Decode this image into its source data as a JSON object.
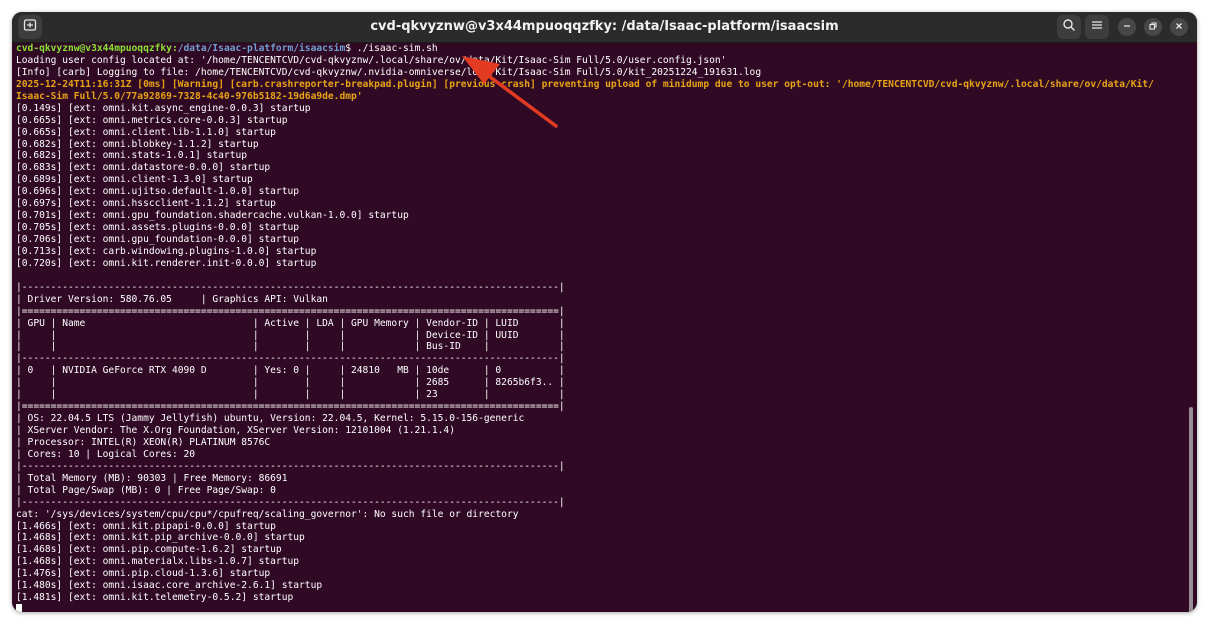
{
  "window": {
    "title": "cvd-qkvyznw@v3x44mpuoqqzfky: /data/Isaac-platform/isaacsim",
    "new_tab_icon": "new-tab-icon",
    "search_icon": "search-icon",
    "menu_icon": "hamburger-menu-icon",
    "minimize_icon": "minimize-icon",
    "maximize_icon": "maximize-icon",
    "close_icon": "close-icon"
  },
  "prompt": {
    "user_host": "cvd-qkvyznw@v3x44mpuoqqzfky",
    "path": "/data/Isaac-platform/isaacsim",
    "symbol": "$",
    "command": " ./isaac-sim.sh"
  },
  "colors": {
    "background": "#300a24",
    "text": "#ffffff",
    "warning": "#e8a316",
    "prompt_user": "#8ae234",
    "prompt_path": "#729fcf",
    "titlebar": "#2b2b2b"
  },
  "lines": [
    {
      "text": "Loading user config located at: '/home/TENCENTCVD/cvd-qkvyznw/.local/share/ov/data/Kit/Isaac-Sim Full/5.0/user.config.json'"
    },
    {
      "text": "[Info] [carb] Logging to file: /home/TENCENTCVD/cvd-qkvyznw/.nvidia-omniverse/logs/Kit/Isaac-Sim Full/5.0/kit_20251224_191631.log"
    },
    {
      "text": "2025-12-24T11:16:31Z [0ms] [Warning] [carb.crashreporter-breakpad.plugin] [previous crash] preventing upload of minidump due to user opt-out: '/home/TENCENTCVD/cvd-qkvyznw/.local/share/ov/data/Kit/",
      "style": "warn"
    },
    {
      "text": "Isaac-Sim Full/5.0/77a92869-7328-4c40-976b5182-19d6a9de.dmp'",
      "style": "warn"
    },
    {
      "text": "[0.149s] [ext: omni.kit.async_engine-0.0.3] startup"
    },
    {
      "text": "[0.665s] [ext: omni.metrics.core-0.0.3] startup"
    },
    {
      "text": "[0.665s] [ext: omni.client.lib-1.1.0] startup"
    },
    {
      "text": "[0.682s] [ext: omni.blobkey-1.1.2] startup"
    },
    {
      "text": "[0.682s] [ext: omni.stats-1.0.1] startup"
    },
    {
      "text": "[0.683s] [ext: omni.datastore-0.0.0] startup"
    },
    {
      "text": "[0.689s] [ext: omni.client-1.3.0] startup"
    },
    {
      "text": "[0.696s] [ext: omni.ujitso.default-1.0.0] startup"
    },
    {
      "text": "[0.697s] [ext: omni.hsscclient-1.1.2] startup"
    },
    {
      "text": "[0.701s] [ext: omni.gpu_foundation.shadercache.vulkan-1.0.0] startup"
    },
    {
      "text": "[0.705s] [ext: omni.assets.plugins-0.0.0] startup"
    },
    {
      "text": "[0.706s] [ext: omni.gpu_foundation-0.0.0] startup"
    },
    {
      "text": "[0.713s] [ext: carb.windowing.plugins-1.0.0] startup"
    },
    {
      "text": "[0.720s] [ext: omni.kit.renderer.init-0.0.0] startup"
    },
    {
      "text": ""
    },
    {
      "text": "|---------------------------------------------------------------------------------------------|"
    },
    {
      "text": "| Driver Version: 580.76.05     | Graphics API: Vulkan"
    },
    {
      "text": "|=============================================================================================|"
    },
    {
      "text": "| GPU | Name                             | Active | LDA | GPU Memory | Vendor-ID | LUID       |"
    },
    {
      "text": "|     |                                  |        |     |            | Device-ID | UUID       |"
    },
    {
      "text": "|     |                                  |        |     |            | Bus-ID    |            |"
    },
    {
      "text": "|---------------------------------------------------------------------------------------------|"
    },
    {
      "text": "| 0   | NVIDIA GeForce RTX 4090 D        | Yes: 0 |     | 24810   MB | 10de      | 0          |"
    },
    {
      "text": "|     |                                  |        |     |            | 2685      | 8265b6f3.. |"
    },
    {
      "text": "|     |                                  |        |     |            | 23        |            |"
    },
    {
      "text": "|=============================================================================================|"
    },
    {
      "text": "| OS: 22.04.5 LTS (Jammy Jellyfish) ubuntu, Version: 22.04.5, Kernel: 5.15.0-156-generic"
    },
    {
      "text": "| XServer Vendor: The X.Org Foundation, XServer Version: 12101004 (1.21.1.4)"
    },
    {
      "text": "| Processor: INTEL(R) XEON(R) PLATINUM 8576C"
    },
    {
      "text": "| Cores: 10 | Logical Cores: 20"
    },
    {
      "text": "|---------------------------------------------------------------------------------------------|"
    },
    {
      "text": "| Total Memory (MB): 90303 | Free Memory: 86691"
    },
    {
      "text": "| Total Page/Swap (MB): 0 | Free Page/Swap: 0"
    },
    {
      "text": "|---------------------------------------------------------------------------------------------|"
    },
    {
      "text": "cat: '/sys/devices/system/cpu/cpu*/cpufreq/scaling_governor': No such file or directory"
    },
    {
      "text": "[1.466s] [ext: omni.kit.pipapi-0.0.0] startup"
    },
    {
      "text": "[1.468s] [ext: omni.kit.pip_archive-0.0.0] startup"
    },
    {
      "text": "[1.468s] [ext: omni.pip.compute-1.6.2] startup"
    },
    {
      "text": "[1.468s] [ext: omni.materialx.libs-1.0.7] startup"
    },
    {
      "text": "[1.476s] [ext: omni.pip.cloud-1.3.6] startup"
    },
    {
      "text": "[1.480s] [ext: omni.isaac.core_archive-2.6.1] startup"
    },
    {
      "text": "[1.481s] [ext: omni.kit.telemetry-0.5.2] startup"
    }
  ]
}
